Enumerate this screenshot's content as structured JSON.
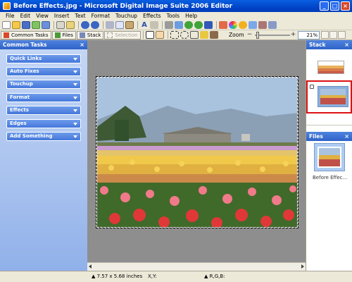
{
  "window": {
    "title": "Before Effects.jpg - Microsoft Digital Image Suite 2006 Editor",
    "controls": [
      "_",
      "□",
      "×"
    ]
  },
  "menu": [
    "File",
    "Edit",
    "View",
    "Insert",
    "Text",
    "Format",
    "Touchup",
    "Effects",
    "Tools",
    "Help"
  ],
  "tabs": {
    "common_tasks": "Common Tasks",
    "files": "Files",
    "stack": "Stack",
    "selection": "Selection"
  },
  "zoom": {
    "label": "Zoom",
    "minus": "−",
    "plus": "+",
    "value": "21%"
  },
  "common_tasks": {
    "title": "Common Tasks",
    "close": "×",
    "items": [
      "Quick Links",
      "Auto Fixes",
      "Touchup",
      "Format",
      "Effects",
      "Edges",
      "Add Something"
    ]
  },
  "stack": {
    "title": "Stack",
    "close": "×"
  },
  "files": {
    "title": "Files",
    "close": "×",
    "filename": "Before Effec..."
  },
  "status": {
    "size": "▲ 7.57 x 5.68 inches",
    "xy": "X,Y:",
    "rgb": "▲ R,G,B:"
  },
  "colors": {
    "title_bar": "#0045c9",
    "pane_header": "#2e62c8",
    "task_button": "#4477db",
    "canvas_bg": "#8e8e8e",
    "selection_outline": "#dd1111"
  }
}
